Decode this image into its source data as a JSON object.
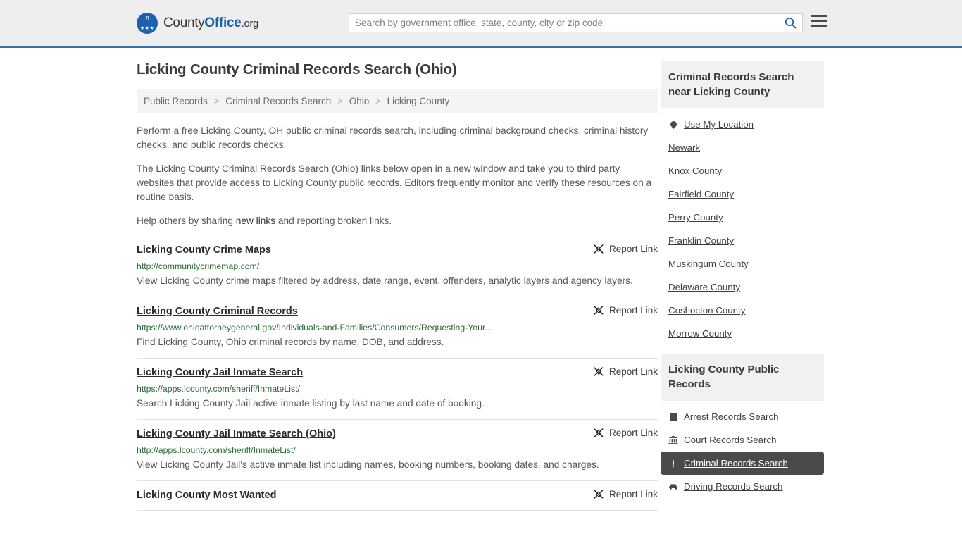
{
  "brand": {
    "name_part1": "County",
    "name_part2": "Office",
    "name_part3": ".org",
    "logo_icon": "eagle-seal-icon",
    "eagle_glyph": "ᵑ",
    "stars_glyph": "★★★"
  },
  "search": {
    "placeholder": "Search by government office, state, county, city or zip code",
    "value": "",
    "search_icon": "search-icon",
    "menu_icon": "hamburger-menu-icon"
  },
  "header": {
    "accent_color": "#3a72a8",
    "background": "#eeeeee"
  },
  "main": {
    "title": "Licking County Criminal Records Search (Ohio)",
    "breadcrumb": [
      "Public Records",
      "Criminal Records Search",
      "Ohio",
      "Licking County"
    ],
    "breadcrumb_separator": ">",
    "intro": [
      "Perform a free Licking County, OH public criminal records search, including criminal background checks, criminal history checks, and public records checks.",
      "The Licking County Criminal Records Search (Ohio) links below open in a new window and take you to third party websites that provide access to Licking County public records. Editors frequently monitor and verify these resources on a routine basis."
    ],
    "help_prefix": "Help others by sharing ",
    "help_link": "new links",
    "help_suffix": " and reporting broken links.",
    "report_label": "Report Link",
    "report_icon": "broken-link-icon",
    "results": [
      {
        "title": "Licking County Crime Maps",
        "url": "http://communitycrimemap.com/",
        "description": "View Licking County crime maps filtered by address, date range, event, offenders, analytic layers and agency layers."
      },
      {
        "title": "Licking County Criminal Records",
        "url": "https://www.ohioattorneygeneral.gov/Individuals-and-Families/Consumers/Requesting-Your...",
        "description": "Find Licking County, Ohio criminal records by name, DOB, and address."
      },
      {
        "title": "Licking County Jail Inmate Search",
        "url": "https://apps.lcounty.com/sheriff/InmateList/",
        "description": "Search Licking County Jail active inmate listing by last name and date of booking."
      },
      {
        "title": "Licking County Jail Inmate Search (Ohio)",
        "url": "http://apps.lcounty.com/sheriff/InmateList/",
        "description": "View Licking County Jail's active inmate list including names, booking numbers, booking dates, and charges."
      },
      {
        "title": "Licking County Most Wanted",
        "url": "",
        "description": ""
      }
    ]
  },
  "sidebar": {
    "nearby": {
      "heading": "Criminal Records Search near Licking County",
      "items": [
        {
          "label": "Use My Location",
          "icon": "map-pin-icon"
        },
        {
          "label": "Newark",
          "icon": ""
        },
        {
          "label": "Knox County",
          "icon": ""
        },
        {
          "label": "Fairfield County",
          "icon": ""
        },
        {
          "label": "Perry County",
          "icon": ""
        },
        {
          "label": "Franklin County",
          "icon": ""
        },
        {
          "label": "Muskingum County",
          "icon": ""
        },
        {
          "label": "Delaware County",
          "icon": ""
        },
        {
          "label": "Coshocton County",
          "icon": ""
        },
        {
          "label": "Morrow County",
          "icon": ""
        }
      ]
    },
    "public_records": {
      "heading": "Licking County Public Records",
      "active_label": "Criminal Records Search",
      "active_background": "#4a4a4a",
      "items": [
        {
          "label": "Arrest Records Search",
          "icon": "arrest-square-icon",
          "active": false
        },
        {
          "label": "Court Records Search",
          "icon": "courthouse-icon",
          "active": false
        },
        {
          "label": "Criminal Records Search",
          "icon": "exclamation-icon",
          "active": true
        },
        {
          "label": "Driving Records Search",
          "icon": "car-icon",
          "active": false
        }
      ]
    }
  }
}
